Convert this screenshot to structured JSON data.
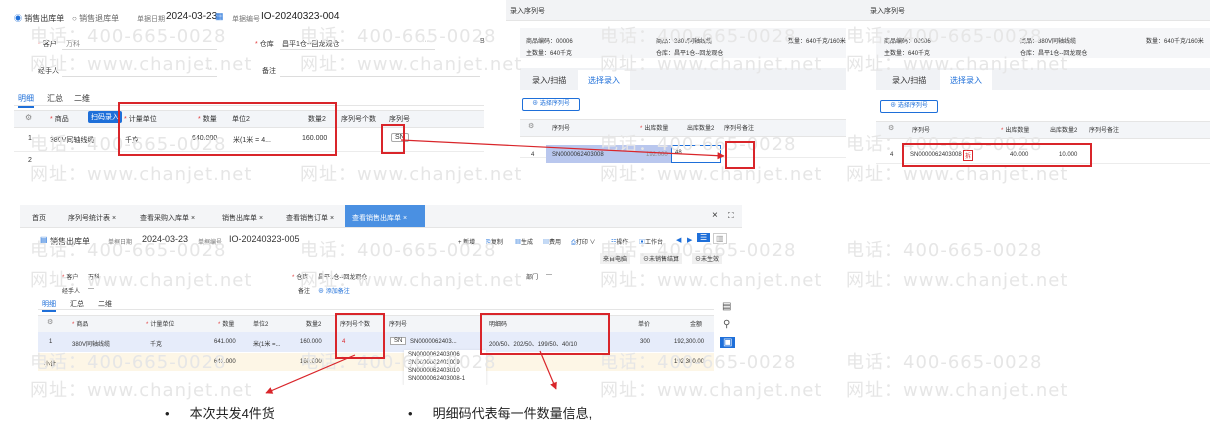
{
  "p1": {
    "radio_out": "销售出库单",
    "radio_return": "销售退库单",
    "date_label": "单据日期",
    "date_value": "2024-03-23",
    "no_label": "单据编号",
    "no_value": "IO-20240323-004",
    "customer_label": "客户",
    "customer_value": "万科",
    "warehouse_label": "仓库",
    "warehouse_value": "昌平1仓--回龙观仓",
    "handler_label": "经手人",
    "remark_label": "备注",
    "ellipsis": "···",
    "tabs": [
      "明细",
      "汇总",
      "二维"
    ],
    "col_product": "商品",
    "scan_btn": "扫码录入",
    "col_unit": "计量单位",
    "col_qty": "数量",
    "col_unit2": "单位2",
    "col_qty2": "数量2",
    "col_sn_count": "序列号个数",
    "col_sn": "序列号",
    "row1_no": "1",
    "row1_product": "380V同轴线缆",
    "row1_unit": "千克",
    "row1_qty": "640.000",
    "row1_unit2": "米(1米 = 4...",
    "row1_qty2": "160.000",
    "row1_sn": "SN",
    "row2_no": "2",
    "settings_icon": "gear-icon",
    "calendar_icon": "calendar-icon"
  },
  "p2": {
    "title": "录入序列号",
    "code_label": "商品编码：",
    "code_value": "00006",
    "name_label": "商品：",
    "name_value": "380V同轴线缆",
    "qty_label": "数量：",
    "qty_value": "640千克/160米",
    "unit_label": "主数量：",
    "unit_value": "640千克",
    "wh_label": "仓库：",
    "wh_value": "昌平1仓--回龙观仓",
    "tab_scan": "录入/扫描",
    "tab_select": "选择录入",
    "select_btn": "选择序列号",
    "col_sn": "序列号",
    "col_outqty": "出库数量",
    "col_outqty2": "出库数量2",
    "col_note": "序列号备注",
    "row_no": "4",
    "row_sn": "SN0000062403008",
    "row_outqty": "192.000",
    "row_input": "48"
  },
  "p3": {
    "title": "录入序列号",
    "code_label": "商品编码：",
    "code_value": "00006",
    "name_label": "商品：",
    "name_value": "380V同轴线缆",
    "qty_label": "数量：",
    "qty_value": "640千克/160米",
    "unit_label": "主数量：",
    "unit_value": "640千克",
    "wh_label": "仓库：",
    "wh_value": "昌平1仓--回龙观仓",
    "tab_scan": "录入/扫描",
    "tab_select": "选择录入",
    "select_btn": "选择序列号",
    "col_sn": "序列号",
    "col_outqty": "出库数量",
    "col_outqty2": "出库数量2",
    "col_note": "序列号备注",
    "row_no": "4",
    "row_sn": "SN0000062403008",
    "row_tag": "拆",
    "row_outqty": "40.000",
    "row_outqty2": "10.000"
  },
  "p4": {
    "nav_tabs": [
      "首页",
      "序列号统计表 ×",
      "查看采购入库单 ×",
      "销售出库单 ×",
      "查看销售订单 ×",
      "查看销售出库单 ×"
    ],
    "close_icon": "×",
    "doc_type": "销售出库单",
    "date_label": "单据日期",
    "date_value": "2024-03-23",
    "no_label": "单据编号",
    "no_value": "IO-20240323-005",
    "toolbar": [
      "+ 新增",
      "复制",
      "生成",
      "费用",
      "打印",
      "操作",
      "工作台"
    ],
    "from_label": "来自电脑",
    "status1": "未销售结算",
    "status2": "未生效",
    "customer_label": "客户",
    "customer_value": "万科",
    "warehouse_label": "仓库",
    "warehouse_value": "昌平1仓--回龙观仓",
    "dept_label": "部门",
    "dept_value": "---",
    "handler_label": "经手人",
    "handler_value": "---",
    "remark_label": "备注",
    "add_remark": "添加备注",
    "tabs": [
      "明细",
      "汇总",
      "二维"
    ],
    "col_product": "商品",
    "col_unit": "计量单位",
    "col_qty": "数量",
    "col_unit2": "单位2",
    "col_qty2": "数量2",
    "col_sn_count": "序列号个数",
    "col_sn": "序列号",
    "col_detail": "明细码",
    "col_price": "单价",
    "col_amount": "金额",
    "row_no": "1",
    "row_product": "380V同轴线缆",
    "row_unit": "千克",
    "row_qty": "641.000",
    "row_unit2": "米(1米 =...",
    "row_qty2": "160.000",
    "row_sn_count": "4",
    "row_sn_tag": "SN",
    "row_sn": "SN0000062403...",
    "row_detail": "200/50、202/50、199/50、40/10",
    "row_price": "300",
    "row_amount": "192,300.00",
    "sum_label": "小计",
    "sum_qty": "641.000",
    "sum_qty2": "160.000",
    "sum_amount": "192,300.00",
    "sn_list": [
      "SN0000062403006",
      "SN0000062403009",
      "SN0000062403010",
      "SN0000062403008-1"
    ]
  },
  "bullets": {
    "b1": "本次共发4件货",
    "b2": "明细码代表每一件数量信息,"
  },
  "watermark": {
    "phone": "电话：400-665-0028",
    "site": "网址：www.chanjet.net"
  },
  "colors": {
    "accent": "#1e6fd9",
    "annotation_red": "#d9252a",
    "selection": "#b9c7ee"
  }
}
